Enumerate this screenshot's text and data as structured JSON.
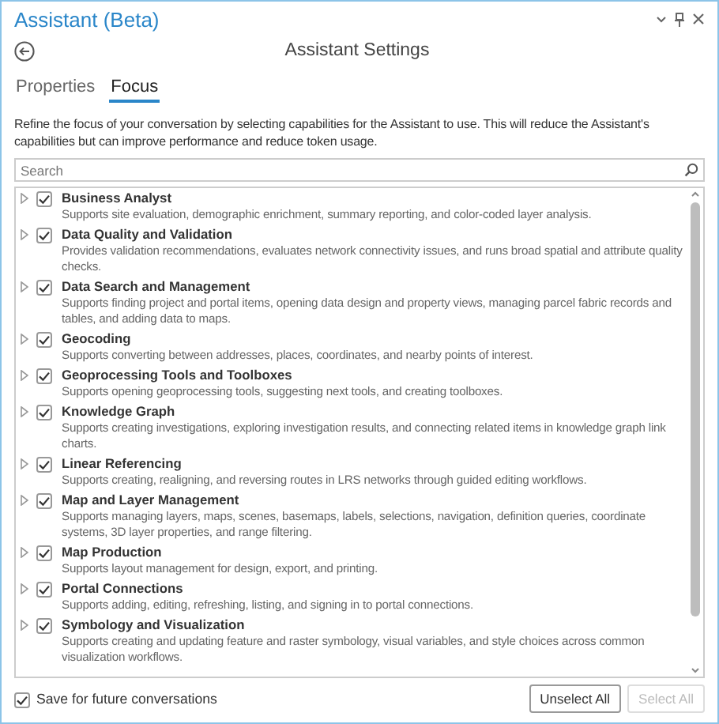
{
  "window": {
    "title": "Assistant (Beta)"
  },
  "header": {
    "title": "Assistant Settings"
  },
  "tabs": [
    {
      "label": "Properties",
      "selected": false
    },
    {
      "label": "Focus",
      "selected": true
    }
  ],
  "intro": "Refine the focus of your conversation by selecting capabilities for the Assistant to use. This will reduce the Assistant's capabilities but can improve performance and reduce token usage.",
  "search": {
    "placeholder": "Search"
  },
  "items": [
    {
      "title": "Business Analyst",
      "description": "Supports site evaluation, demographic enrichment, summary reporting, and color-coded layer analysis.",
      "checked": true,
      "expanded": false
    },
    {
      "title": "Data Quality and Validation",
      "description": "Provides validation recommendations, evaluates network connectivity issues, and runs broad spatial and attribute quality checks.",
      "checked": true,
      "expanded": false
    },
    {
      "title": "Data Search and Management",
      "description": "Supports finding project and portal items, opening data design and property views, managing parcel fabric records and tables, and adding data to maps.",
      "checked": true,
      "expanded": false
    },
    {
      "title": "Geocoding",
      "description": "Supports converting between addresses, places, coordinates, and nearby points of interest.",
      "checked": true,
      "expanded": false
    },
    {
      "title": "Geoprocessing Tools and Toolboxes",
      "description": "Supports opening geoprocessing tools, suggesting next tools, and creating toolboxes.",
      "checked": true,
      "expanded": false
    },
    {
      "title": "Knowledge Graph",
      "description": "Supports creating investigations, exploring investigation results, and connecting related items in knowledge graph link charts.",
      "checked": true,
      "expanded": false
    },
    {
      "title": "Linear Referencing",
      "description": "Supports creating, realigning, and reversing routes in LRS networks through guided editing workflows.",
      "checked": true,
      "expanded": false
    },
    {
      "title": "Map and Layer Management",
      "description": "Supports managing layers, maps, scenes, basemaps, labels, selections, navigation, definition queries, coordinate systems, 3D layer properties, and range filtering.",
      "checked": true,
      "expanded": false
    },
    {
      "title": "Map Production",
      "description": "Supports layout management for design, export, and printing.",
      "checked": true,
      "expanded": false
    },
    {
      "title": "Portal Connections",
      "description": "Supports adding, editing, refreshing, listing, and signing in to portal connections.",
      "checked": true,
      "expanded": false
    },
    {
      "title": "Symbology and Visualization",
      "description": "Supports creating and updating feature and raster symbology, visual variables, and style choices across common visualization workflows.",
      "checked": true,
      "expanded": false
    }
  ],
  "save": {
    "label": "Save for future conversations",
    "checked": true
  },
  "buttons": [
    {
      "label": "Unselect All",
      "disabled": false
    },
    {
      "label": "Select All",
      "disabled": true
    }
  ]
}
